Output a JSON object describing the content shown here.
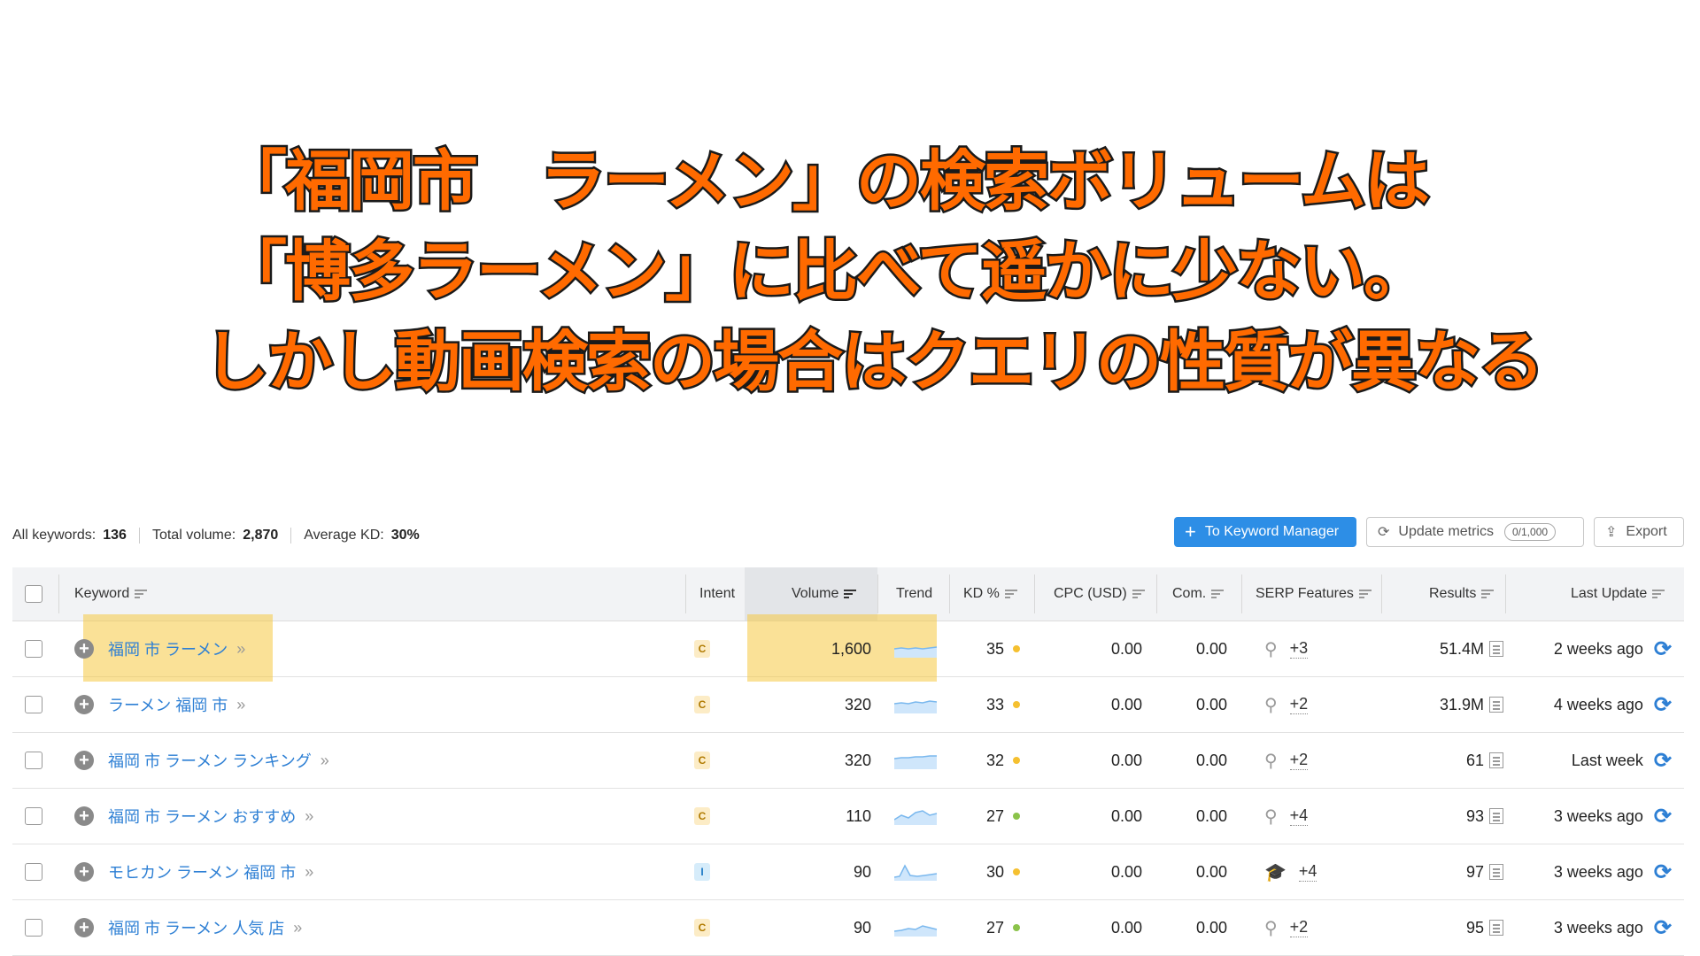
{
  "headline": {
    "line1": "「福岡市　ラーメン」の検索ボリュームは",
    "line2": "「博多ラーメン」に比べて遥かに少ない。",
    "line3": "しかし動画検索の場合はクエリの性質が異なる",
    "fill_color": "#ff6a00",
    "stroke_color": "#1a1a1a"
  },
  "stats": {
    "all_keywords_label": "All keywords:",
    "all_keywords_value": "136",
    "total_volume_label": "Total volume:",
    "total_volume_value": "2,870",
    "average_kd_label": "Average KD:",
    "average_kd_value": "30%"
  },
  "toolbar": {
    "keyword_manager_label": "To Keyword Manager",
    "update_metrics_label": "Update metrics",
    "update_quota": "0/1,000",
    "export_label": "Export"
  },
  "table": {
    "headers": {
      "keyword": "Keyword",
      "intent": "Intent",
      "volume": "Volume",
      "trend": "Trend",
      "kd": "KD %",
      "cpc": "CPC (USD)",
      "com": "Com.",
      "serp": "SERP Features",
      "results": "Results",
      "last_update": "Last Update"
    },
    "rows": [
      {
        "keyword": "福岡 市 ラーメン",
        "intent": "C",
        "volume": "1,600",
        "kd": "35",
        "kd_color": "#f5c030",
        "cpc": "0.00",
        "com": "0.00",
        "serp_icon": "location-pin-icon",
        "serp_more": "+3",
        "results": "51.4M",
        "last_update": "2 weeks ago",
        "highlighted": true
      },
      {
        "keyword": "ラーメン 福岡 市",
        "intent": "C",
        "volume": "320",
        "kd": "33",
        "kd_color": "#f5c030",
        "cpc": "0.00",
        "com": "0.00",
        "serp_icon": "location-pin-icon",
        "serp_more": "+2",
        "results": "31.9M",
        "last_update": "4 weeks ago",
        "highlighted": false
      },
      {
        "keyword": "福岡 市 ラーメン ランキング",
        "intent": "C",
        "volume": "320",
        "kd": "32",
        "kd_color": "#f5c030",
        "cpc": "0.00",
        "com": "0.00",
        "serp_icon": "location-pin-icon",
        "serp_more": "+2",
        "results": "61",
        "last_update": "Last week",
        "highlighted": false
      },
      {
        "keyword": "福岡 市 ラーメン おすすめ",
        "intent": "C",
        "volume": "110",
        "kd": "27",
        "kd_color": "#8bc34a",
        "cpc": "0.00",
        "com": "0.00",
        "serp_icon": "location-pin-icon",
        "serp_more": "+4",
        "results": "93",
        "last_update": "3 weeks ago",
        "highlighted": false
      },
      {
        "keyword": "モヒカン ラーメン 福岡 市",
        "intent": "I",
        "volume": "90",
        "kd": "30",
        "kd_color": "#f5c030",
        "cpc": "0.00",
        "com": "0.00",
        "serp_icon": "graduation-cap-icon",
        "serp_more": "+4",
        "results": "97",
        "last_update": "3 weeks ago",
        "highlighted": false
      },
      {
        "keyword": "福岡 市 ラーメン 人気 店",
        "intent": "C",
        "volume": "90",
        "kd": "27",
        "kd_color": "#8bc34a",
        "cpc": "0.00",
        "com": "0.00",
        "serp_icon": "location-pin-icon",
        "serp_more": "+2",
        "results": "95",
        "last_update": "3 weeks ago",
        "highlighted": false
      }
    ]
  }
}
